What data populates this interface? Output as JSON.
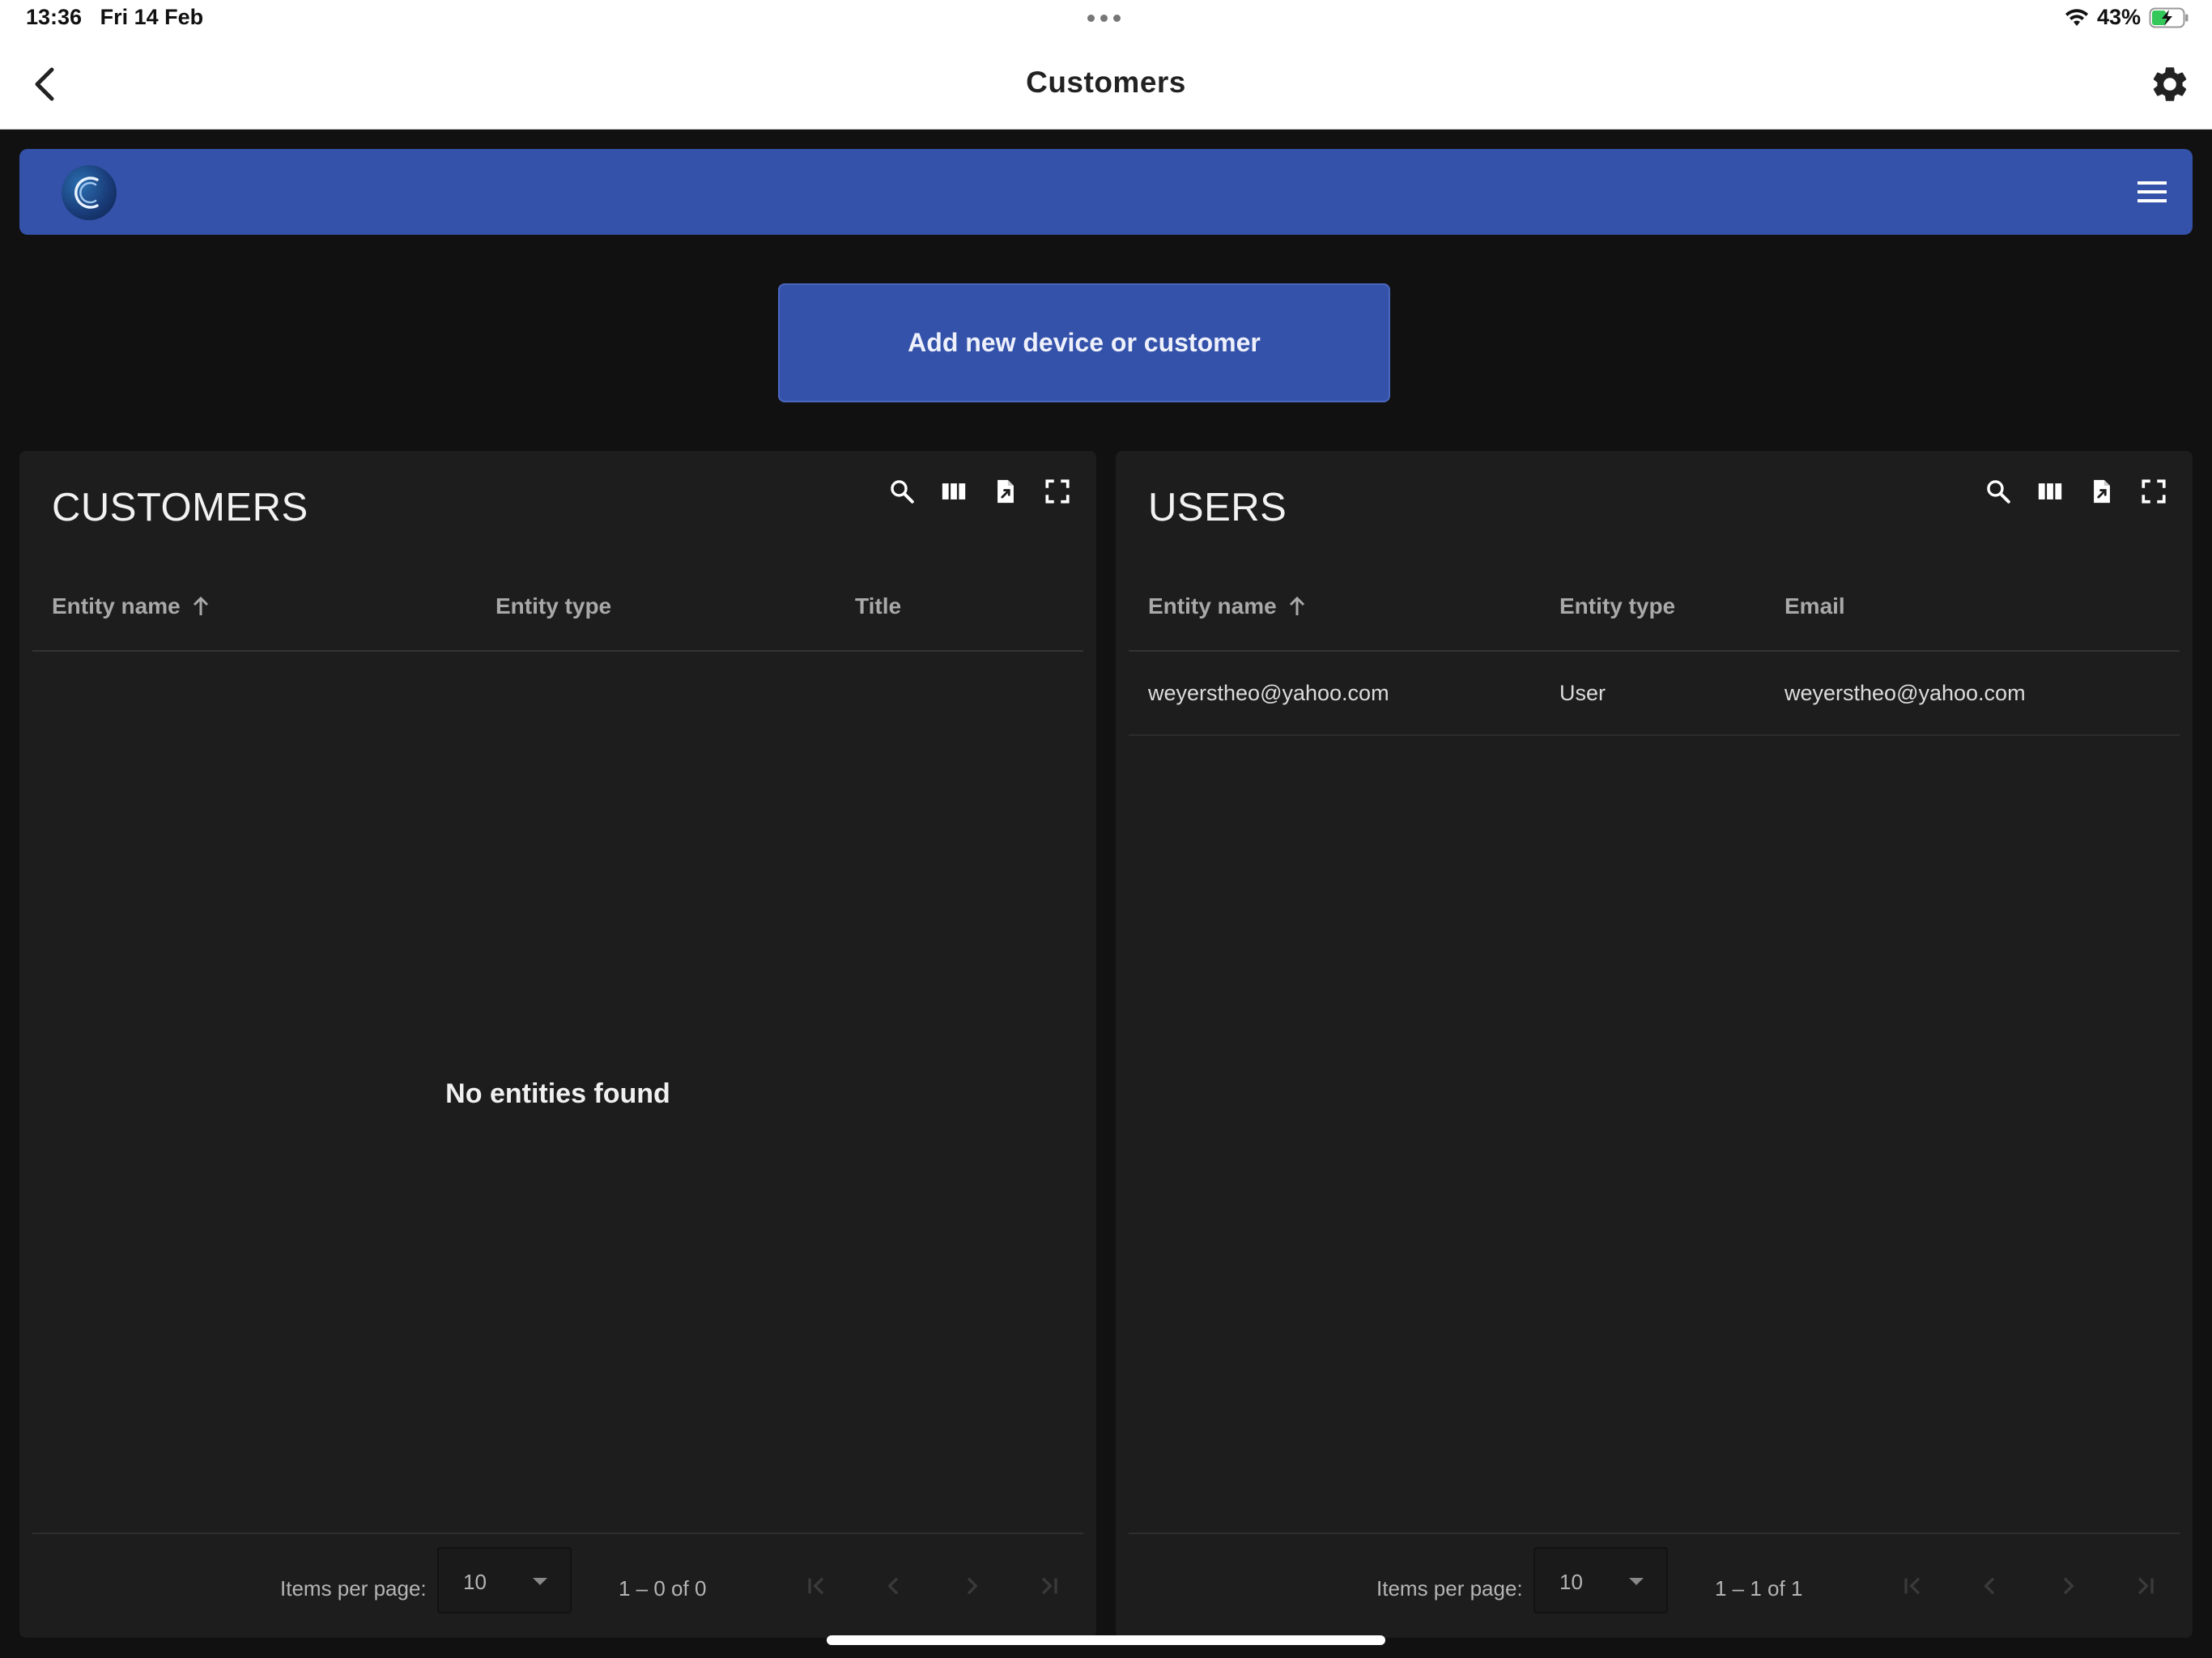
{
  "status_bar": {
    "time": "13:36",
    "date": "Fri 14 Feb",
    "battery": "43%"
  },
  "nav": {
    "title": "Customers"
  },
  "actions": {
    "add_label": "Add new device or customer"
  },
  "customers": {
    "title": "CUSTOMERS",
    "columns": [
      "Entity name",
      "Entity type",
      "Title"
    ],
    "empty_message": "No entities found",
    "items_per_page_label": "Items per page:",
    "items_per_page": "10",
    "range": "1 – 0 of 0"
  },
  "users": {
    "title": "USERS",
    "columns": [
      "Entity name",
      "Entity type",
      "Email"
    ],
    "rows": [
      {
        "name": "weyerstheo@yahoo.com",
        "type": "User",
        "email": "weyerstheo@yahoo.com"
      }
    ],
    "items_per_page_label": "Items per page:",
    "items_per_page": "10",
    "range": "1 – 1 of 1"
  },
  "colors": {
    "primary": "#3452aa",
    "background": "#111111",
    "panel": "#1d1d1d"
  }
}
